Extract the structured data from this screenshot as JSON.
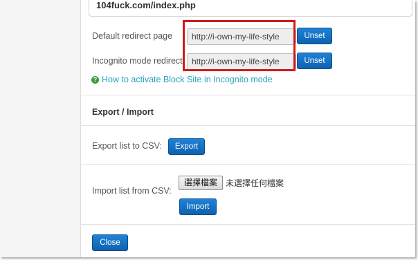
{
  "header": {
    "url": "104fuck.com/index.php"
  },
  "redirect": {
    "default_label": "Default redirect page",
    "default_value": "http://i-own-my-life-style",
    "incognito_label": "Incognito mode redirect",
    "incognito_value": "http://i-own-my-life-style",
    "unset_label": "Unset",
    "help_link": "How to activate Block Site in Incognito mode"
  },
  "export_import": {
    "title": "Export / Import",
    "export_label": "Export list to CSV:",
    "export_button": "Export",
    "import_label": "Import list from CSV:",
    "file_button": "選擇檔案",
    "file_status": "未選擇任何檔案",
    "import_button": "Import"
  },
  "footer": {
    "close_button": "Close"
  },
  "colors": {
    "accent": "#1470c2",
    "link": "#2aa1c0",
    "highlight": "#d11919",
    "help_icon": "#3a9b3a"
  }
}
